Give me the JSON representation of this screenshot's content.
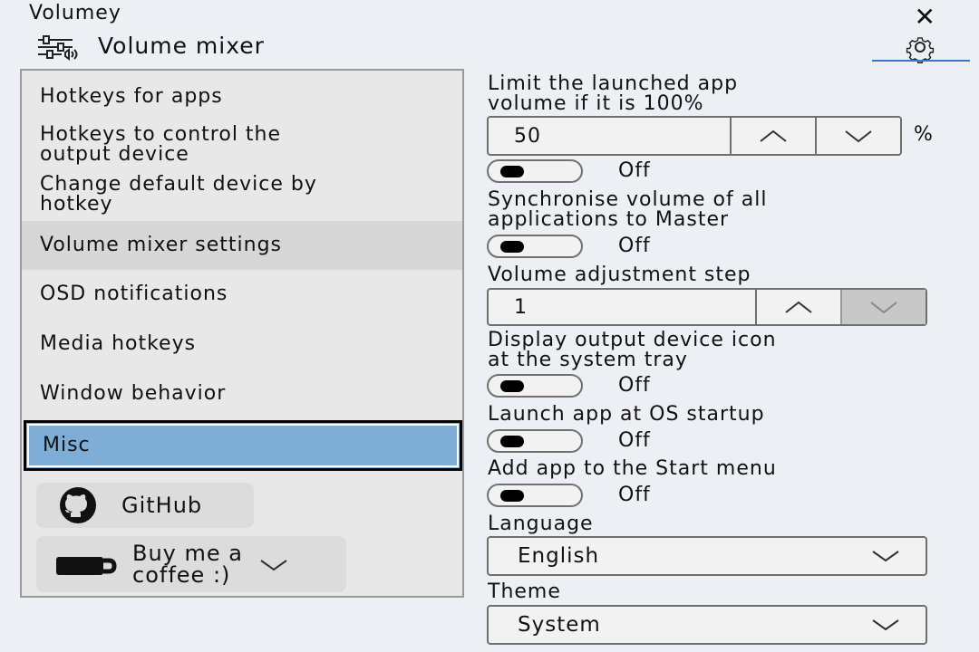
{
  "window": {
    "title": "Volumey",
    "close_glyph": "✕"
  },
  "header": {
    "title": "Volume mixer",
    "icon": "sliders-icon",
    "settings_icon": "gear-icon"
  },
  "sidebar": {
    "items": [
      {
        "line1": "Hotkeys for apps",
        "line2": ""
      },
      {
        "line1": "Hotkeys to control the",
        "line2": "output device"
      },
      {
        "line1": "Change default device by",
        "line2": "hotkey"
      },
      {
        "line1": "Volume mixer settings",
        "line2": ""
      },
      {
        "line1": "OSD notifications",
        "line2": ""
      },
      {
        "line1": "Media hotkeys",
        "line2": ""
      },
      {
        "line1": "Window behavior",
        "line2": ""
      },
      {
        "line1": "Misc",
        "line2": ""
      }
    ],
    "github_label": "GitHub",
    "coffee_line1": "Buy me a",
    "coffee_line2": "coffee :)"
  },
  "settings": {
    "limit_label_1": "Limit the launched app",
    "limit_label_2": "volume if it is 100%",
    "limit_value": "50",
    "limit_unit": "%",
    "limit_toggle": "Off",
    "sync_label_1": "Synchronise volume of all",
    "sync_label_2": "applications to Master",
    "sync_toggle": "Off",
    "step_label": "Volume adjustment step",
    "step_value": "1",
    "tray_label_1": "Display output device icon",
    "tray_label_2": "at the system tray",
    "tray_toggle": "Off",
    "startup_label": "Launch app at OS startup",
    "startup_toggle": "Off",
    "startmenu_label": "Add app to the Start menu",
    "startmenu_toggle": "Off",
    "language_label": "Language",
    "language_value": "English",
    "theme_label": "Theme",
    "theme_value": "System"
  },
  "colors": {
    "accent": "#3b78c6",
    "selected_bg": "#7eadd6",
    "active_bg": "#d7d7d7",
    "window_bg": "#eceff3"
  }
}
